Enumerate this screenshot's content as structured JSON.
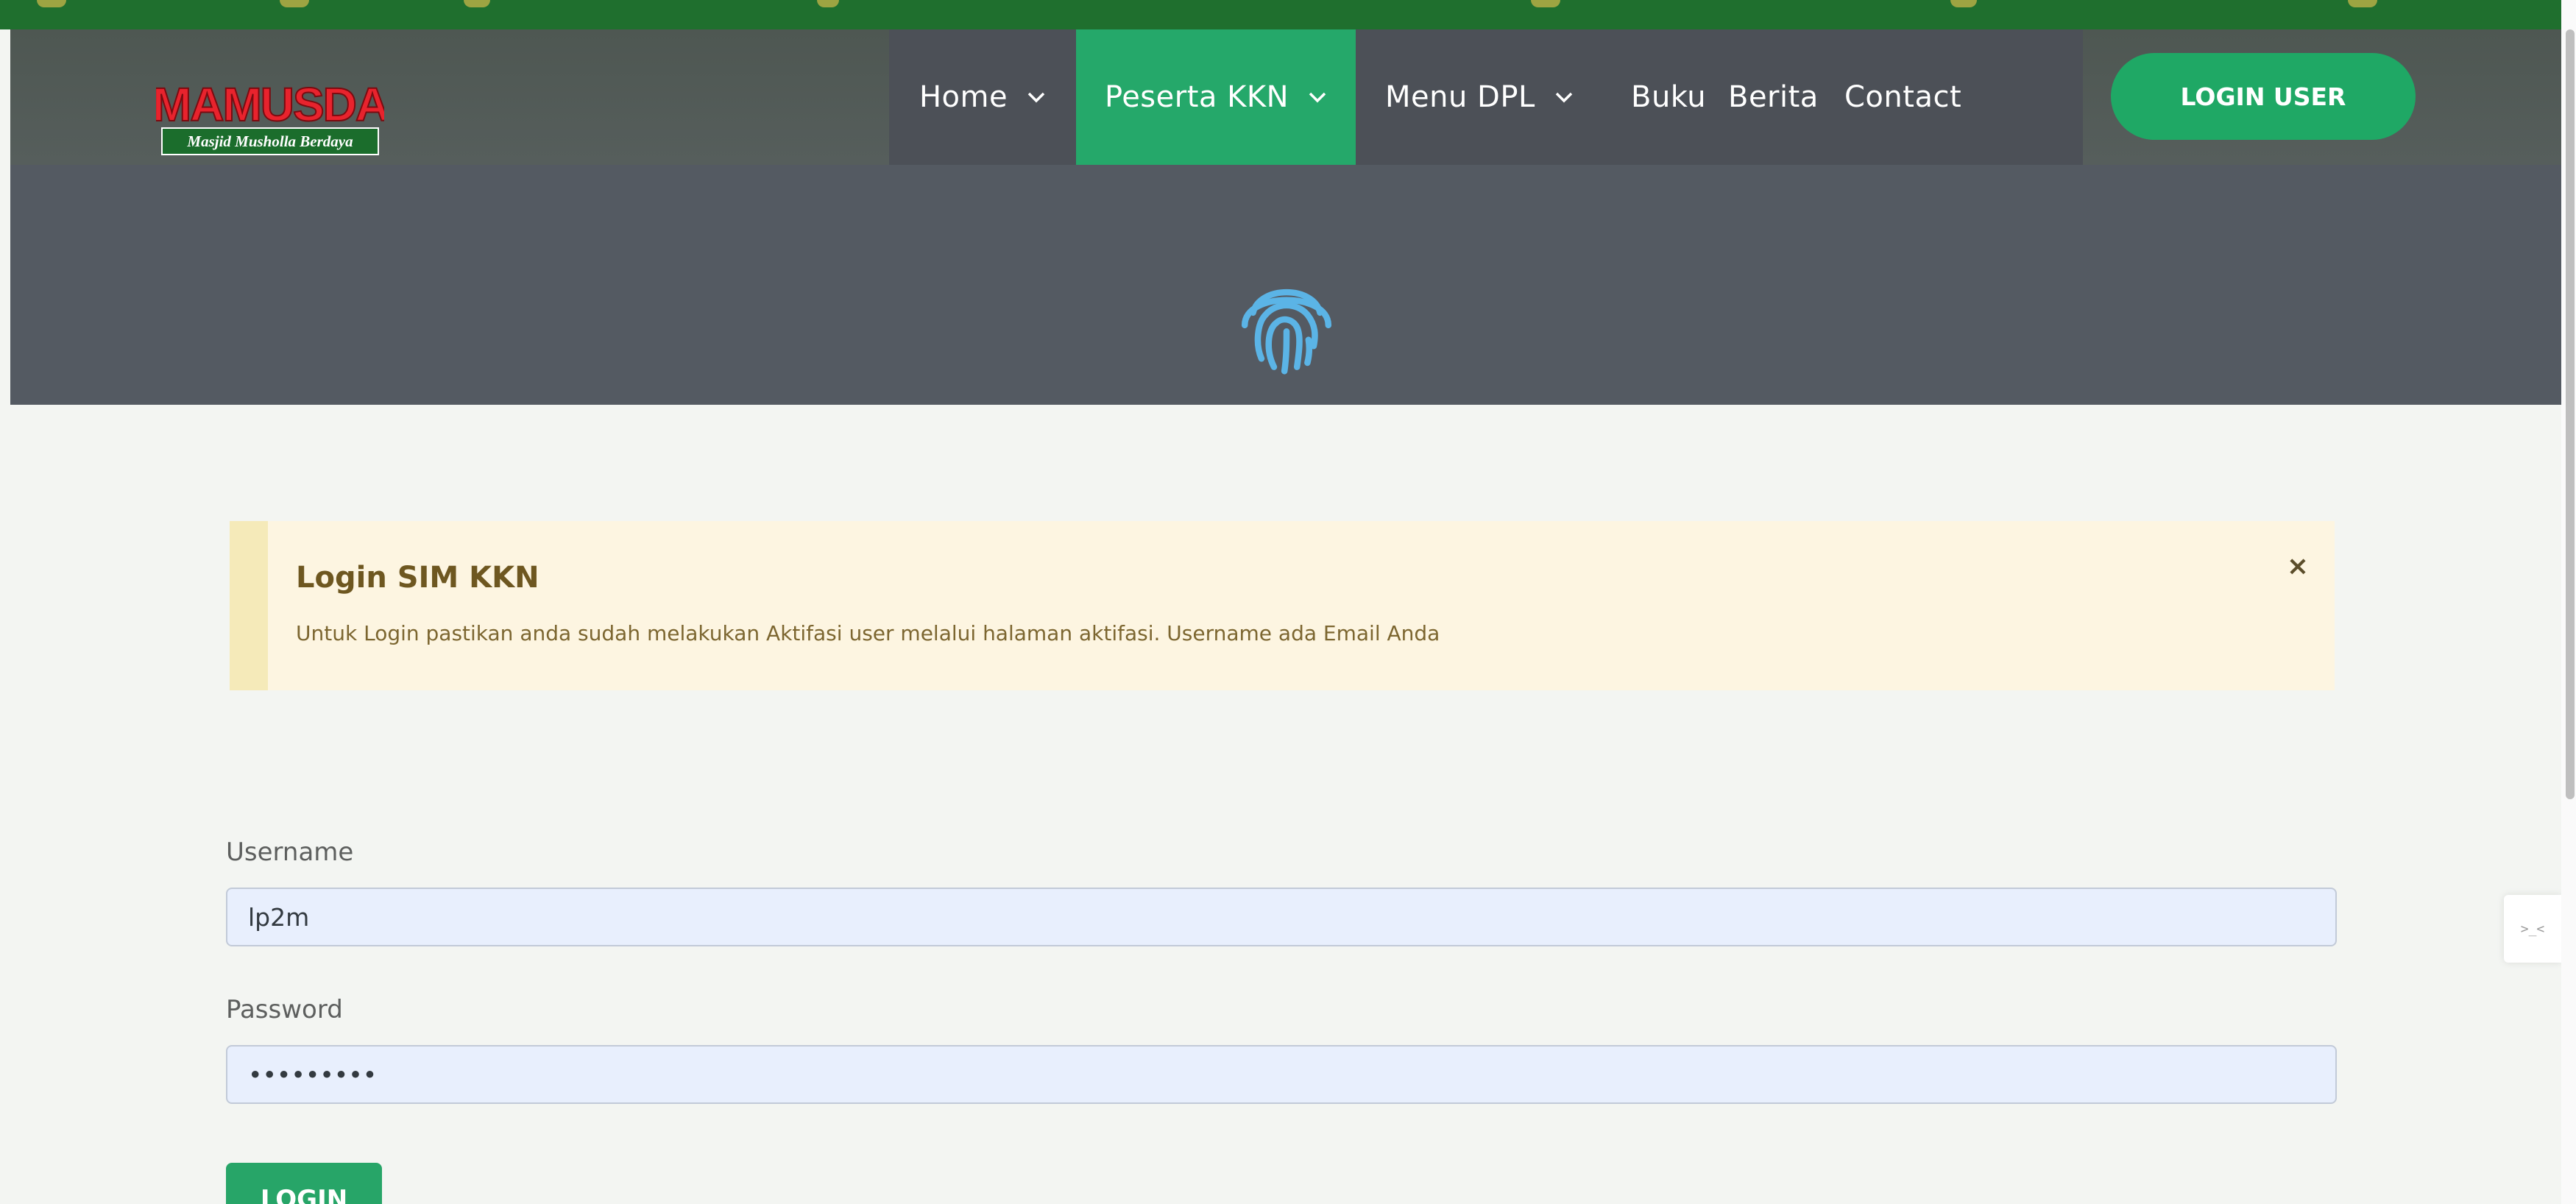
{
  "brand": {
    "logo_title": "MAMUSDA",
    "logo_tagline": "Masjid Musholla Berdaya"
  },
  "nav": {
    "items": [
      {
        "label": "Home",
        "has_dropdown": true,
        "active": false
      },
      {
        "label": "Peserta KKN",
        "has_dropdown": true,
        "active": true
      },
      {
        "label": "Menu DPL",
        "has_dropdown": true,
        "active": false
      },
      {
        "label": "Buku",
        "has_dropdown": false,
        "active": false
      },
      {
        "label": "Berita",
        "has_dropdown": false,
        "active": false
      },
      {
        "label": "Contact",
        "has_dropdown": false,
        "active": false
      }
    ],
    "login_user_label": "LOGIN USER"
  },
  "hero": {
    "icon": "fingerprint-icon"
  },
  "alert": {
    "title": "Login SIM KKN",
    "message": "Untuk Login pastikan anda sudah melakukan Aktifasi user melalui halaman aktifasi. Username ada Email Anda",
    "close_symbol": "×"
  },
  "form": {
    "username_label": "Username",
    "username_value": "lp2m",
    "password_label": "Password",
    "password_value": "secretpwd",
    "submit_label": "LOGIN"
  },
  "side_widget": {
    "text": ">_<"
  },
  "colors": {
    "accent_green": "#25a86a",
    "header_bg": "#4e5752",
    "nav_bg": "#4c5057",
    "hero_bg": "#545a62",
    "fingerprint": "#5bb4e6",
    "alert_bg": "#fdf5e1",
    "input_bg": "#e8effd"
  }
}
